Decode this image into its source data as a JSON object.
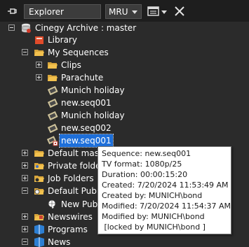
{
  "header": {
    "explorer_label": "Explorer",
    "mru_label": "MRU",
    "pin_icon": "pin-icon",
    "layout_icon": "layout-icon",
    "close_icon": "close-icon"
  },
  "tree": {
    "root": "Cinegy Archive : master",
    "library": "Library",
    "my_sequences": "My Sequences",
    "clips": "Clips",
    "parachute": "Parachute",
    "seq1": "Munich holiday",
    "seq2": "new.seq001",
    "seq3": "Munich holiday",
    "seq4": "new.seq002",
    "seq5": "new.seq001",
    "default_master": "Default master",
    "private_folder": "Private folder",
    "job_folders": "Job Folders",
    "default_public": "Default Public",
    "new_public": "New Publi",
    "newswires": "Newswires",
    "programs": "Programs",
    "news": "News"
  },
  "tooltip": {
    "line1": "Sequence: new.seq001",
    "line2": "TV format: 1080p/25",
    "line3": "Duration: 00:00:15:20",
    "line4": "Created: 7/20/2024 11:53:49 AM",
    "line5": "Created by: MUNICH\\bond",
    "line6": "Modified: 7/20/2024 11:54:37 AM",
    "line7": "Modified by: MUNICH\\bond",
    "line8": " [locked by MUNICH\\bond ]"
  },
  "colors": {
    "background": "#2b2b2b",
    "header": "#1e1e1e",
    "selection": "#1e6fd9",
    "folder": "#f2c14e"
  }
}
